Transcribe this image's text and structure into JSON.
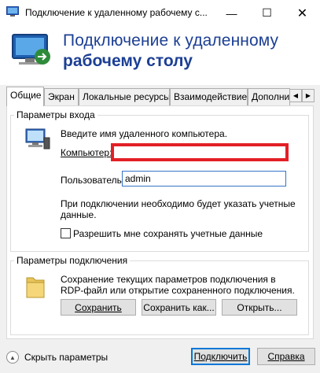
{
  "window": {
    "title": "Подключение к удаленному рабочему с...",
    "minimize_glyph": "—",
    "maximize_glyph": "☐",
    "close_glyph": "✕"
  },
  "banner": {
    "line1": "Подключение к удаленному",
    "line2": "рабочему столу"
  },
  "tabs": [
    {
      "label": "Общие",
      "active": true
    },
    {
      "label": "Экран",
      "active": false
    },
    {
      "label": "Локальные ресурсы",
      "active": false
    },
    {
      "label": "Взаимодействие",
      "active": false
    },
    {
      "label": "Дополни",
      "active": false
    }
  ],
  "tab_scroll": {
    "left": "◀",
    "right": "▶"
  },
  "login_group": {
    "title": "Параметры входа",
    "prompt": "Введите имя удаленного компьютера.",
    "computer_label": "Компьютер:",
    "computer_value": "",
    "user_label": "Пользователь:",
    "user_value": "admin",
    "info": "При подключении необходимо будет указать учетные данные.",
    "save_credentials_label": "Разрешить мне сохранять учетные данные",
    "save_credentials_checked": false
  },
  "connection_group": {
    "title": "Параметры подключения",
    "description": "Сохранение текущих параметров подключения в RDP-файл или открытие сохраненного подключения.",
    "save_label": "Сохранить",
    "save_as_label": "Сохранить как...",
    "open_label": "Открыть..."
  },
  "footer": {
    "hide_params_label": "Скрыть параметры",
    "hide_params_glyph": "▲",
    "connect_label": "Подключить",
    "help_label": "Справка"
  },
  "colors": {
    "accent_title": "#1c3f94",
    "highlight_border": "#e31f26",
    "focus_blue": "#0078d7"
  },
  "icons": [
    "rdp-app-icon",
    "rdp-banner-icon",
    "computer-icon",
    "folder-icon",
    "collapse-arrow-icon"
  ]
}
